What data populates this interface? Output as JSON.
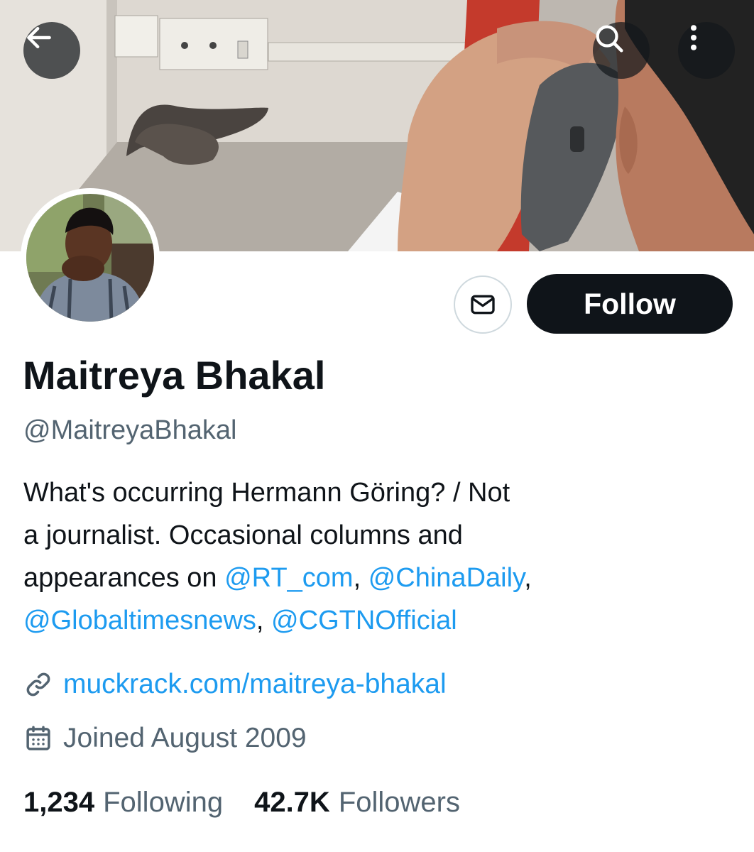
{
  "profile": {
    "display_name": "Maitreya Bhakal",
    "handle": "@MaitreyaBhakal",
    "bio": {
      "line1": "What's occurring Hermann Göring?  / Not",
      "line2": "a journalist. Occasional columns and",
      "line3_prefix": "appearances on ",
      "mention_rt": "@RT_com",
      "sep1": ", ",
      "mention_chinadaily": "@ChinaDaily",
      "sep2": ",",
      "mention_globaltimes": "@Globaltimesnews",
      "sep3": ", ",
      "mention_cgtn": "@CGTNOfficial"
    },
    "website": "muckrack.com/maitreya-bhakal",
    "joined": "Joined August 2009"
  },
  "actions": {
    "follow_label": "Follow"
  },
  "stats": {
    "following_count": "1,234",
    "following_label": "Following",
    "followers_count": "42.7K",
    "followers_label": "Followers"
  },
  "icons": {
    "back": "arrow-left-icon",
    "search": "search-icon",
    "more": "more-vertical-icon",
    "message": "mail-icon",
    "link": "link-icon",
    "calendar": "calendar-icon"
  },
  "colors": {
    "text": "#0f1419",
    "secondary": "#536471",
    "accent": "#1d9bf0",
    "follow_bg": "#0f1419"
  }
}
